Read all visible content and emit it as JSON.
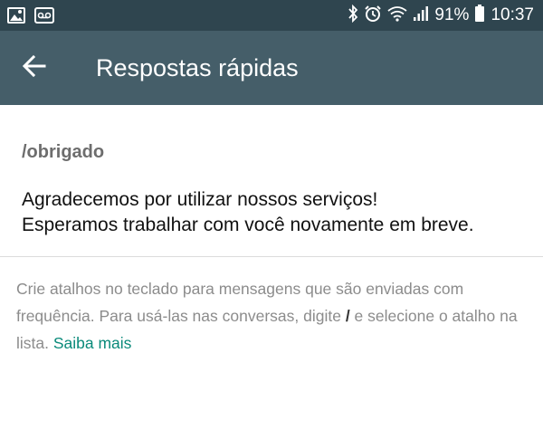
{
  "status_bar": {
    "battery_percent": "91%",
    "time": "10:37",
    "left_icons": [
      "image-icon",
      "voicemail-icon"
    ],
    "right_icons": [
      "bluetooth-icon",
      "alarm-icon",
      "wifi-icon",
      "signal-icon",
      "battery-icon"
    ]
  },
  "app_bar": {
    "title": "Respostas rápidas",
    "back_icon": "arrow-back-icon",
    "color": "#455e69",
    "status_color": "#2f454f"
  },
  "reply": {
    "shortcut": "/obrigado",
    "message_line1": "Agradecemos por utilizar nossos serviços!",
    "message_line2": "Esperamos trabalhar com você novamente em breve."
  },
  "help": {
    "text_part1": "Crie atalhos no teclado para mensagens que são enviadas com frequência. Para usá-las nas conversas, digite ",
    "slash": "/",
    "text_part2": " e selecione o atalho na lista. ",
    "learn_more": "Saiba mais",
    "link_color": "#0a8a7a"
  }
}
